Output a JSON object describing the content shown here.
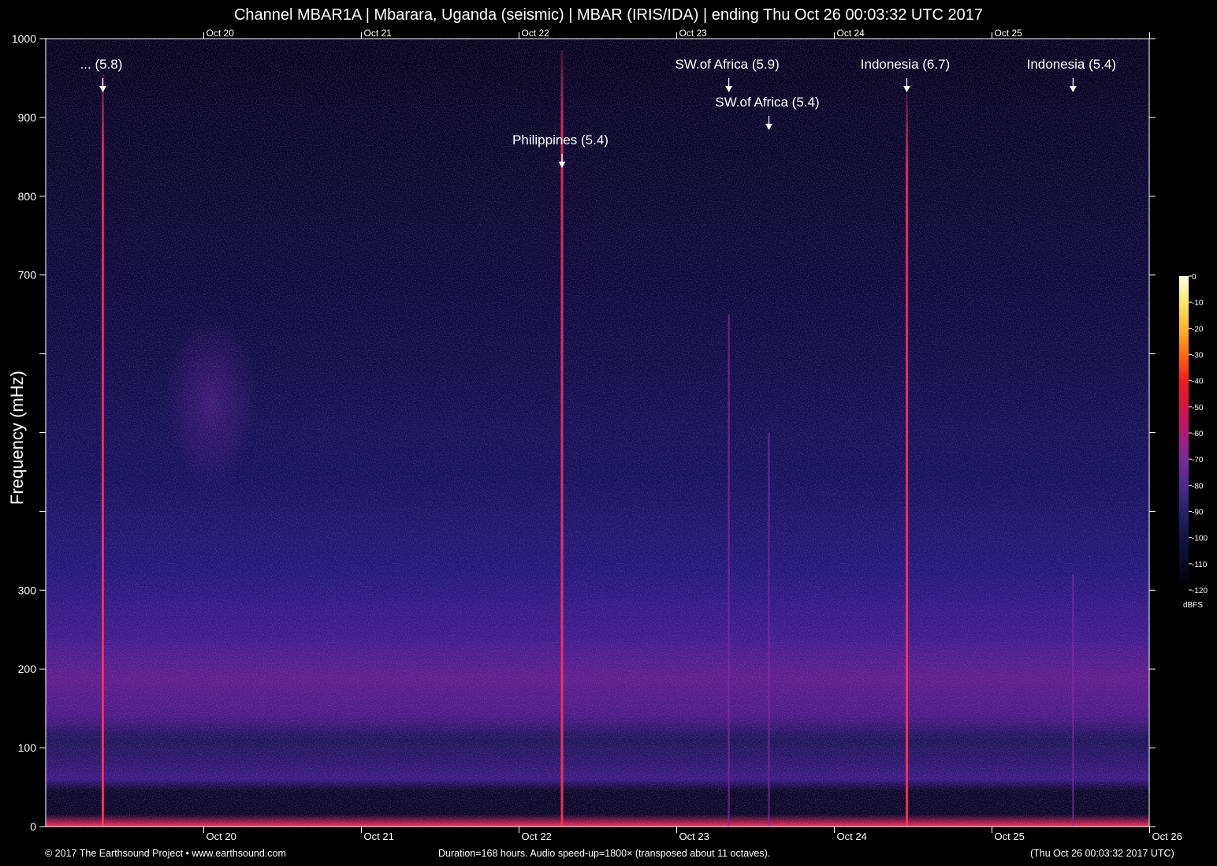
{
  "chart_data": {
    "type": "heatmap",
    "title": "Channel MBAR1A | Mbarara, Uganda (seismic) | MBAR (IRIS/IDA) | ending Thu Oct 26 00:03:32 UTC 2017",
    "ylabel": "Frequency (mHz)",
    "xlabel": "",
    "ylim": [
      0,
      1000
    ],
    "y_ticks": [
      {
        "value": 0,
        "label": "0"
      },
      {
        "value": 100,
        "label": "100"
      },
      {
        "value": 200,
        "label": "200"
      },
      {
        "value": 300,
        "label": "300"
      },
      {
        "value": 400,
        "label": ""
      },
      {
        "value": 500,
        "label": ""
      },
      {
        "value": 600,
        "label": ""
      },
      {
        "value": 700,
        "label": "700"
      },
      {
        "value": 800,
        "label": "800"
      },
      {
        "value": 900,
        "label": "900"
      },
      {
        "value": 1000,
        "label": "1000"
      }
    ],
    "x_range_hours": [
      0,
      168
    ],
    "x_ticks": [
      {
        "hour": 24.06,
        "label": "Oct 20"
      },
      {
        "hour": 48.06,
        "label": "Oct 21"
      },
      {
        "hour": 72.06,
        "label": "Oct 22"
      },
      {
        "hour": 96.06,
        "label": "Oct 23"
      },
      {
        "hour": 120.06,
        "label": "Oct 24"
      },
      {
        "hour": 144.06,
        "label": "Oct 25"
      },
      {
        "hour": 168.06,
        "label": "Oct 26"
      }
    ],
    "events": [
      {
        "label": "... (5.8)",
        "hour": 8.7,
        "mag": 5.8,
        "label_freq": 962,
        "arrow_freq": 950,
        "line_top": 955
      },
      {
        "label": "Philippines (5.4)",
        "hour": 78.6,
        "mag": 5.4,
        "label_freq": 866,
        "arrow_freq": 854,
        "line_top": 985
      },
      {
        "label": "SW.of Africa (5.9)",
        "hour": 104.0,
        "mag": 5.9,
        "label_freq": 962,
        "arrow_freq": 950,
        "line_top": 650
      },
      {
        "label": "SW.of Africa (5.4)",
        "hour": 110.1,
        "mag": 5.4,
        "label_freq": 914,
        "arrow_freq": 902,
        "line_top": 500
      },
      {
        "label": "Indonesia (6.7)",
        "hour": 131.1,
        "mag": 6.7,
        "label_freq": 962,
        "arrow_freq": 950,
        "line_top": 930
      },
      {
        "label": "Indonesia (5.4)",
        "hour": 156.4,
        "mag": 5.4,
        "label_freq": 962,
        "arrow_freq": 950,
        "line_top": 320
      }
    ],
    "colorbar": {
      "unit": "dBFS",
      "range": [
        -120,
        0
      ],
      "tick_labels": [
        "0",
        "-10",
        "-20",
        "-30",
        "-40",
        "-50",
        "-60",
        "-70",
        "-80",
        "-90",
        "-100",
        "-110",
        "-120"
      ],
      "colors": [
        "#ffffe0",
        "#ffe66a",
        "#ffb52a",
        "#ff6a10",
        "#f01c1c",
        "#d8124a",
        "#b01a78",
        "#7a2a9a",
        "#4a2a90",
        "#28206a",
        "#141448",
        "#0a0a26",
        "#000000"
      ]
    },
    "grid": false
  },
  "footer": {
    "left": "© 2017 The Earthsound Project • www.earthsound.com",
    "center": "Duration=168 hours. Audio speed-up=1800× (transposed about 11 octaves).",
    "right": "(Thu Oct 26 00:03:32 2017 UTC)"
  }
}
